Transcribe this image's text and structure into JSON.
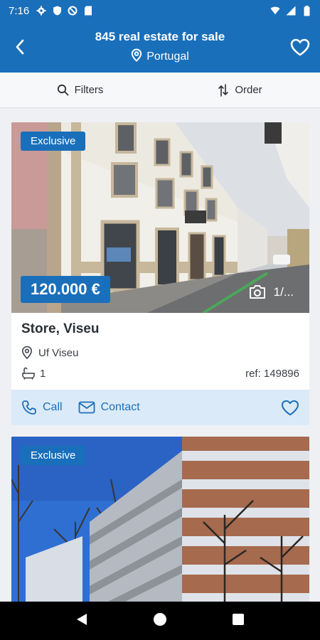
{
  "status_bar": {
    "time": "7:16"
  },
  "header": {
    "title": "845 real estate for sale",
    "location": "Portugal"
  },
  "filters": {
    "filters_label": "Filters",
    "order_label": "Order"
  },
  "listings": [
    {
      "badge": "Exclusive",
      "price": "120.000 €",
      "photo_count": "1/...",
      "title": "Store, Viseu",
      "location": "Uf Viseu",
      "bathrooms": "1",
      "ref": "ref: 149896",
      "call_label": "Call",
      "contact_label": "Contact"
    },
    {
      "badge": "Exclusive"
    }
  ],
  "colors": {
    "primary": "#1a6fba",
    "action_bar": "#dbeaf8",
    "background": "#eef0f3"
  }
}
